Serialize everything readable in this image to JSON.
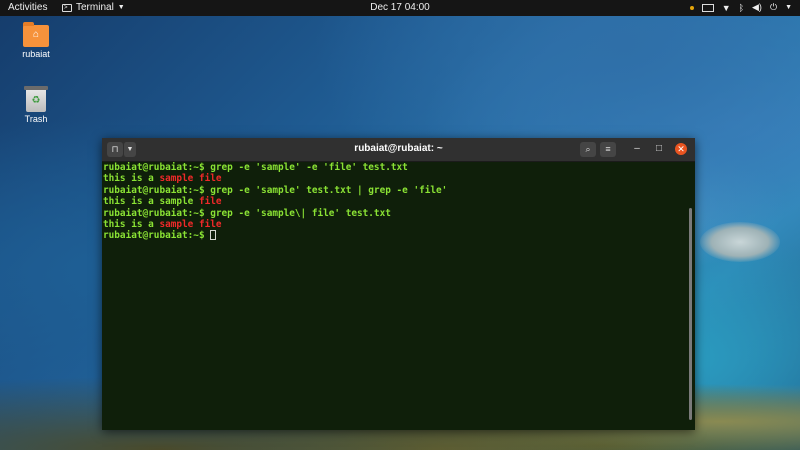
{
  "topbar": {
    "activities": "Activities",
    "app_name": "Terminal",
    "clock": "Dec 17  04:00"
  },
  "desktop": {
    "icons": [
      {
        "label": "rubaiat",
        "icon": "home-folder-icon"
      },
      {
        "label": "Trash",
        "icon": "trash-icon"
      }
    ]
  },
  "terminal": {
    "title": "rubaiat@rubaiat: ~",
    "prompt": "rubaiat@rubaiat:~$ ",
    "lines": [
      {
        "type": "cmd",
        "text": "grep -e 'sample' -e 'file' test.txt"
      },
      {
        "type": "out",
        "pre": "this is a ",
        "match1": "sample",
        "mid": " ",
        "match2": "file"
      },
      {
        "type": "cmd",
        "text": "grep -e 'sample' test.txt | grep -e 'file'"
      },
      {
        "type": "out",
        "pre": "this is a sample ",
        "match1": "",
        "mid": "",
        "match2": "file"
      },
      {
        "type": "cmd",
        "text": "grep -e 'sample\\| file' test.txt"
      },
      {
        "type": "out",
        "pre": "this is a ",
        "match1": "sample",
        "mid": " ",
        "match2": "file"
      }
    ]
  },
  "colors": {
    "prompt": "#8ae234",
    "match": "#ef2929",
    "terminal_bg": "#0f1f0a",
    "close_button": "#e95420"
  }
}
